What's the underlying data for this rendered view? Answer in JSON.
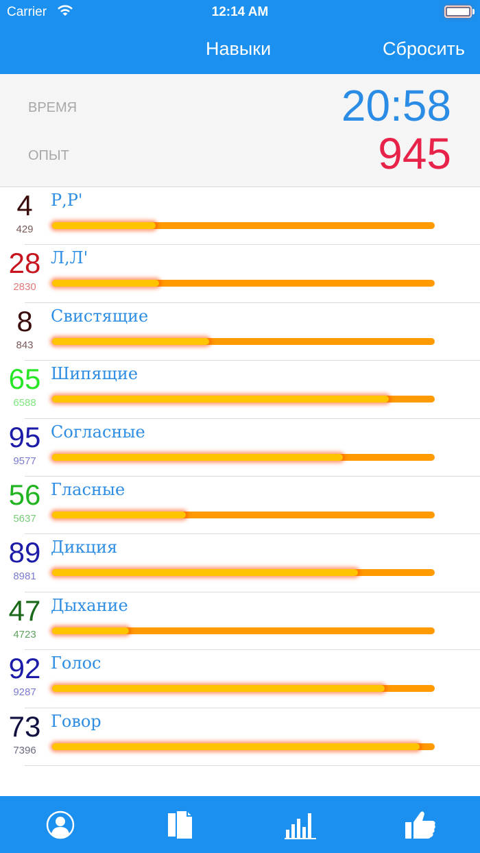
{
  "status_bar": {
    "carrier": "Carrier",
    "time": "12:14 AM"
  },
  "nav": {
    "title": "Навыки",
    "reset_label": "Сбросить"
  },
  "summary": {
    "time_label": "ВРЕМЯ",
    "time_value": "20:58",
    "xp_label": "ОПЫТ",
    "xp_value": "945"
  },
  "skills": [
    {
      "level": "4",
      "points": "429",
      "name": "Р,Р'",
      "progress": 0.27,
      "level_color": "#3a0e0e",
      "points_color": "#7a5a5a"
    },
    {
      "level": "28",
      "points": "2830",
      "name": "Л,Л'",
      "progress": 0.28,
      "level_color": "#c8141e",
      "points_color": "#e07a7a"
    },
    {
      "level": "8",
      "points": "843",
      "name": "Свистящие",
      "progress": 0.41,
      "level_color": "#3a0e0e",
      "points_color": "#7a5a5a"
    },
    {
      "level": "65",
      "points": "6588",
      "name": "Шипящие",
      "progress": 0.88,
      "level_color": "#26e626",
      "points_color": "#7ee87e"
    },
    {
      "level": "95",
      "points": "9577",
      "name": "Согласные",
      "progress": 0.76,
      "level_color": "#1c1ca8",
      "points_color": "#7a7ad0"
    },
    {
      "level": "56",
      "points": "5637",
      "name": "Гласные",
      "progress": 0.35,
      "level_color": "#20b420",
      "points_color": "#76cc76"
    },
    {
      "level": "89",
      "points": "8981",
      "name": "Дикция",
      "progress": 0.8,
      "level_color": "#1c1ca8",
      "points_color": "#7a7ad0"
    },
    {
      "level": "47",
      "points": "4723",
      "name": "Дыхание",
      "progress": 0.2,
      "level_color": "#1a6a1a",
      "points_color": "#5fa05f"
    },
    {
      "level": "92",
      "points": "9287",
      "name": "Голос",
      "progress": 0.87,
      "level_color": "#1c1ca8",
      "points_color": "#7a7ad0"
    },
    {
      "level": "73",
      "points": "7396",
      "name": "Говор",
      "progress": 0.96,
      "level_color": "#101040",
      "points_color": "#6a6a80"
    }
  ],
  "tabs": [
    {
      "icon": "profile-icon",
      "active": false
    },
    {
      "icon": "documents-icon",
      "active": false
    },
    {
      "icon": "bar-chart-icon",
      "active": true
    },
    {
      "icon": "thumbs-up-icon",
      "active": false
    }
  ],
  "colors": {
    "bar_blue": "#1c90ee",
    "active_tab": "#4aa9f5",
    "track": "#ff9a00",
    "fill": "#ffc400"
  }
}
